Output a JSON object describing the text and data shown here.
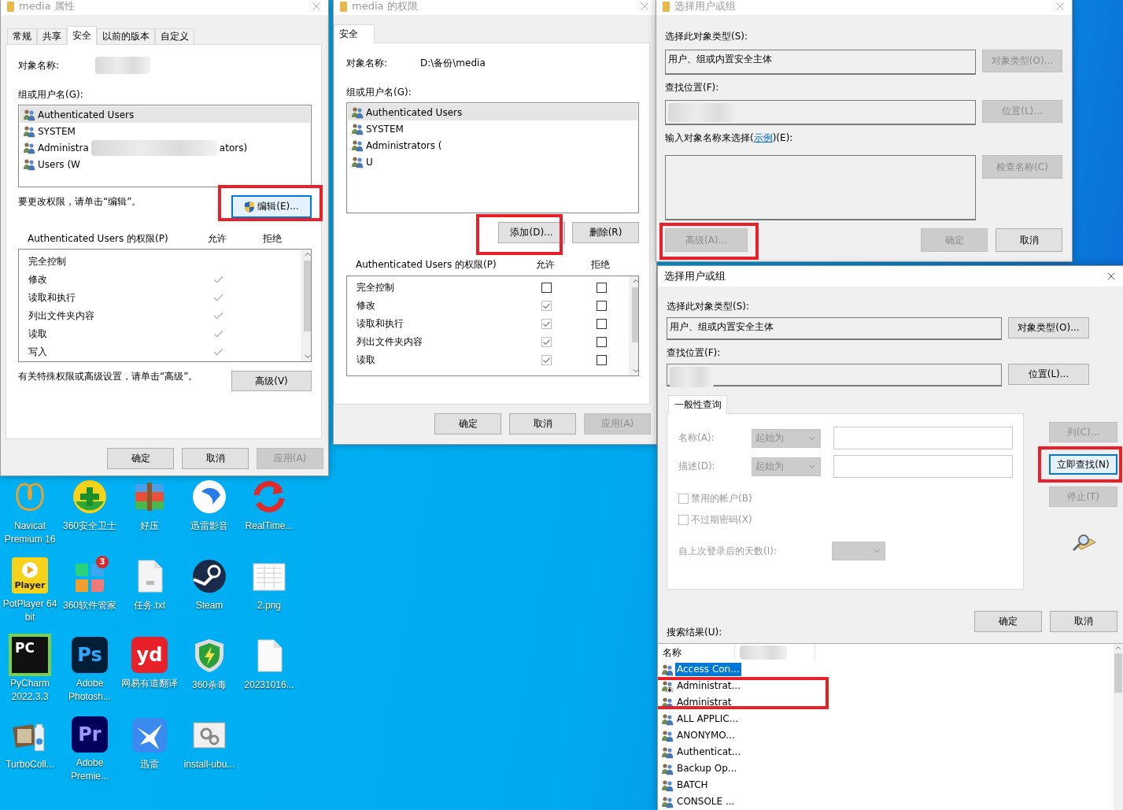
{
  "desktop": {
    "icons": [
      {
        "label": "Navicat Premium 16",
        "kind": "navicat"
      },
      {
        "label": "360安全卫士",
        "kind": "guard"
      },
      {
        "label": "好压",
        "kind": "archive"
      },
      {
        "label": "迅雷影音",
        "kind": "media"
      },
      {
        "label": "RealTime...",
        "kind": "sync"
      },
      {
        "label": "PotPlayer 64 bit",
        "kind": "player",
        "glyph": "Player"
      },
      {
        "label": "360软件管家",
        "kind": "petals",
        "badge": "3"
      },
      {
        "label": "任务.txt",
        "kind": "textfile"
      },
      {
        "label": "Steam",
        "kind": "steam"
      },
      {
        "label": "2.png",
        "kind": "image"
      },
      {
        "label": "PyCharm 2022.3.3",
        "kind": "pycharm",
        "glyph": "PC"
      },
      {
        "label": "Adobe Photosh...",
        "kind": "ps",
        "glyph": "Ps"
      },
      {
        "label": "网易有道翻译",
        "kind": "yd",
        "glyph": "yd"
      },
      {
        "label": "360杀毒",
        "kind": "shield"
      },
      {
        "label": "20231016...",
        "kind": "blankfile"
      },
      {
        "label": "TurboColl...",
        "kind": "collage"
      },
      {
        "label": "Adobe Premie...",
        "kind": "pr",
        "glyph": "Pr"
      },
      {
        "label": "迅雷",
        "kind": "bird"
      },
      {
        "label": "install-ubu...",
        "kind": "installer"
      }
    ]
  },
  "properties_window": {
    "title": "media 属性",
    "active": false,
    "tabs": [
      {
        "label": "常规",
        "selected": false
      },
      {
        "label": "共享",
        "selected": false
      },
      {
        "label": "安全",
        "selected": true
      },
      {
        "label": "以前的版本",
        "selected": false
      },
      {
        "label": "自定义",
        "selected": false
      }
    ],
    "object_label": "对象名称:",
    "group_label": "组或用户名(G):",
    "users": [
      {
        "name": "Authenticated Users",
        "selected": true
      },
      {
        "name": "SYSTEM",
        "selected": false
      },
      {
        "name": "Administra",
        "tail": "ators)",
        "selected": false
      },
      {
        "name": "Users (W",
        "selected": false
      }
    ],
    "edit_note": "要更改权限，请单击“编辑”。",
    "edit_button": {
      "label": "编辑(E)...",
      "kind": "elevated",
      "disabled": false,
      "focused": true
    },
    "permissions_label": "Authenticated Users 的权限(P)",
    "allow_label": "允许",
    "deny_label": "拒绝",
    "permissions": [
      {
        "name": "完全控制",
        "allow": false
      },
      {
        "name": "修改",
        "allow": true
      },
      {
        "name": "读取和执行",
        "allow": true
      },
      {
        "name": "列出文件夹内容",
        "allow": true
      },
      {
        "name": "读取",
        "allow": true
      },
      {
        "name": "写入",
        "allow": true
      }
    ],
    "advanced_note": "有关特殊权限或高级设置，请单击“高级”。",
    "advanced_button": {
      "label": "高级(V)",
      "disabled": false,
      "focused": false
    },
    "buttons": [
      {
        "label": "确定",
        "disabled": false,
        "focused": false
      },
      {
        "label": "取消",
        "disabled": false,
        "focused": false
      },
      {
        "label": "应用(A)",
        "disabled": true,
        "focused": false
      }
    ]
  },
  "permissions_window": {
    "title": "media 的权限",
    "active": false,
    "tabs": [
      {
        "label": "安全",
        "selected": true
      }
    ],
    "object_label": "对象名称:",
    "object_value": "D:\\备份\\media",
    "group_label": "组或用户名(G):",
    "users": [
      {
        "name": "Authenticated Users",
        "selected": true
      },
      {
        "name": "SYSTEM",
        "selected": false
      },
      {
        "name": "Administrators (",
        "selected": false
      },
      {
        "name": "U",
        "selected": false
      }
    ],
    "list_buttons": [
      {
        "label": "添加(D)...",
        "disabled": false,
        "focused": false
      },
      {
        "label": "删除(R)",
        "disabled": false,
        "focused": false
      }
    ],
    "permissions_label": "Authenticated Users 的权限(P)",
    "allow_label": "允许",
    "deny_label": "拒绝",
    "permissions": [
      {
        "name": "完全控制",
        "allow": false,
        "deny": false,
        "inherited": false
      },
      {
        "name": "修改",
        "allow": true,
        "deny": false,
        "inherited": true
      },
      {
        "name": "读取和执行",
        "allow": true,
        "deny": false,
        "inherited": true
      },
      {
        "name": "列出文件夹内容",
        "allow": true,
        "deny": false,
        "inherited": true
      },
      {
        "name": "读取",
        "allow": true,
        "deny": false,
        "inherited": true
      }
    ],
    "buttons": [
      {
        "label": "确定",
        "disabled": false,
        "focused": false
      },
      {
        "label": "取消",
        "disabled": false,
        "focused": false
      },
      {
        "label": "应用(A)",
        "disabled": true,
        "focused": false
      }
    ]
  },
  "select_window": {
    "title": "选择用户或组",
    "active": false,
    "type_label": "选择此对象类型(S):",
    "type_value": "用户、组或内置安全主体",
    "type_button": {
      "label": "对象类型(O)...",
      "disabled": true,
      "focused": false
    },
    "location_label": "查找位置(F):",
    "location_button": {
      "label": "位置(L)...",
      "disabled": true,
      "focused": false
    },
    "names_label_before": "输入对象名称来选择(",
    "names_link": "示例",
    "names_label_after": ")(E):",
    "check_button": {
      "label": "检查名称(C)",
      "disabled": true,
      "focused": false
    },
    "advanced_button": {
      "label": "高级(A)...",
      "disabled": true,
      "focused": false
    },
    "buttons": [
      {
        "label": "确定",
        "disabled": true,
        "focused": false
      },
      {
        "label": "取消",
        "disabled": false,
        "focused": false
      }
    ]
  },
  "advanced_window": {
    "title": "选择用户或组",
    "active": true,
    "type_label": "选择此对象类型(S):",
    "type_value": "用户、组或内置安全主体",
    "type_button": {
      "label": "对象类型(O)...",
      "disabled": false,
      "focused": false
    },
    "location_label": "查找位置(F):",
    "location_button": {
      "label": "位置(L)...",
      "disabled": false,
      "focused": false
    },
    "query_tab": {
      "label": "一般性查询",
      "selected": true
    },
    "query_rows": [
      {
        "label": "名称(A):",
        "dropdown": "起始为"
      },
      {
        "label": "描述(D):",
        "dropdown": "起始为"
      }
    ],
    "query_disabled": true,
    "checkboxes": [
      {
        "label": "禁用的帐户(B)",
        "checked": false
      },
      {
        "label": "不过期密码(X)",
        "checked": false
      }
    ],
    "days_label": "自上次登录后的天数(I):",
    "side_buttons": [
      {
        "label": "列(C)...",
        "disabled": true,
        "focused": false
      },
      {
        "label": "立即查找(N)",
        "disabled": false,
        "focused": true
      },
      {
        "label": "停止(T)",
        "disabled": true,
        "focused": false
      }
    ],
    "buttons": [
      {
        "label": "确定",
        "disabled": false,
        "focused": false
      },
      {
        "label": "取消",
        "disabled": false,
        "focused": false
      }
    ],
    "results_label": "搜索结果(U):",
    "results_columns": [
      "名称"
    ],
    "results": [
      {
        "name": "Access Con...",
        "kind": "group",
        "selected": true
      },
      {
        "name": "Administrat...",
        "kind": "user",
        "selected": false
      },
      {
        "name": "Administrat",
        "kind": "group",
        "selected": false
      },
      {
        "name": "ALL APPLIC...",
        "kind": "group",
        "selected": false
      },
      {
        "name": "ANONYMO...",
        "kind": "group",
        "selected": false
      },
      {
        "name": "Authenticat...",
        "kind": "group",
        "selected": false
      },
      {
        "name": "Backup Op...",
        "kind": "group",
        "selected": false
      },
      {
        "name": "BATCH",
        "kind": "group",
        "selected": false
      },
      {
        "name": "CONSOLE ...",
        "kind": "group",
        "selected": false
      }
    ]
  }
}
